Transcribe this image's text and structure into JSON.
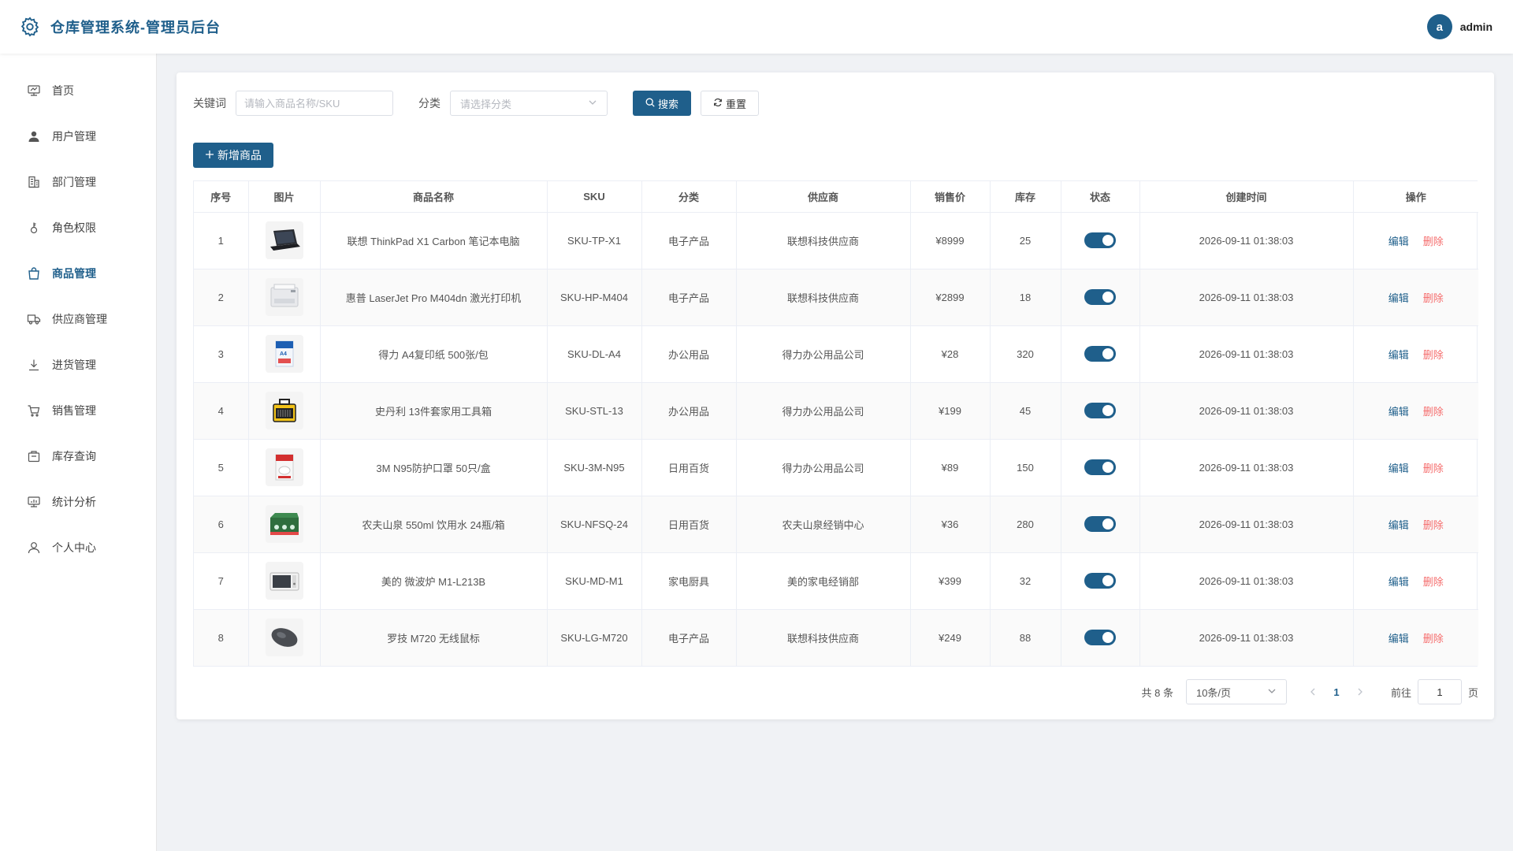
{
  "header": {
    "title": "仓库管理系统-管理员后台",
    "avatar_letter": "a",
    "username": "admin",
    "brand_color": "#1f5f8b"
  },
  "sidebar": {
    "items": [
      {
        "label": "首页",
        "icon": "dashboard-icon"
      },
      {
        "label": "用户管理",
        "icon": "user-icon"
      },
      {
        "label": "部门管理",
        "icon": "building-icon"
      },
      {
        "label": "角色权限",
        "icon": "key-icon"
      },
      {
        "label": "商品管理",
        "icon": "shopping-bag-icon",
        "active": true
      },
      {
        "label": "供应商管理",
        "icon": "truck-icon"
      },
      {
        "label": "进货管理",
        "icon": "download-icon"
      },
      {
        "label": "销售管理",
        "icon": "cart-icon"
      },
      {
        "label": "库存查询",
        "icon": "box-icon"
      },
      {
        "label": "统计分析",
        "icon": "chart-icon"
      },
      {
        "label": "个人中心",
        "icon": "profile-icon"
      }
    ]
  },
  "filters": {
    "keyword_label": "关键词",
    "keyword_placeholder": "请输入商品名称/SKU",
    "category_label": "分类",
    "category_placeholder": "请选择分类",
    "search_label": "搜索",
    "reset_label": "重置"
  },
  "add_button_label": "新增商品",
  "table": {
    "columns": [
      "序号",
      "图片",
      "商品名称",
      "SKU",
      "分类",
      "供应商",
      "销售价",
      "库存",
      "状态",
      "创建时间",
      "操作"
    ],
    "edit_label": "编辑",
    "delete_label": "删除",
    "rows": [
      {
        "index": "1",
        "image": "laptop",
        "name": "联想 ThinkPad X1 Carbon 笔记本电脑",
        "sku": "SKU-TP-X1",
        "category": "电子产品",
        "supplier": "联想科技供应商",
        "price": "¥8999",
        "stock": "25",
        "enabled": true,
        "created": "2026-09-11 01:38:03"
      },
      {
        "index": "2",
        "image": "printer",
        "name": "惠普 LaserJet Pro M404dn 激光打印机",
        "sku": "SKU-HP-M404",
        "category": "电子产品",
        "supplier": "联想科技供应商",
        "price": "¥2899",
        "stock": "18",
        "enabled": true,
        "created": "2026-09-11 01:38:03"
      },
      {
        "index": "3",
        "image": "paper",
        "name": "得力 A4复印纸 500张/包",
        "sku": "SKU-DL-A4",
        "category": "办公用品",
        "supplier": "得力办公用品公司",
        "price": "¥28",
        "stock": "320",
        "enabled": true,
        "created": "2026-09-11 01:38:03"
      },
      {
        "index": "4",
        "image": "toolbox",
        "name": "史丹利 13件套家用工具箱",
        "sku": "SKU-STL-13",
        "category": "办公用品",
        "supplier": "得力办公用品公司",
        "price": "¥199",
        "stock": "45",
        "enabled": true,
        "created": "2026-09-11 01:38:03"
      },
      {
        "index": "5",
        "image": "mask",
        "name": "3M N95防护口罩 50只/盒",
        "sku": "SKU-3M-N95",
        "category": "日用百货",
        "supplier": "得力办公用品公司",
        "price": "¥89",
        "stock": "150",
        "enabled": true,
        "created": "2026-09-11 01:38:03"
      },
      {
        "index": "6",
        "image": "water",
        "name": "农夫山泉 550ml 饮用水 24瓶/箱",
        "sku": "SKU-NFSQ-24",
        "category": "日用百货",
        "supplier": "农夫山泉经销中心",
        "price": "¥36",
        "stock": "280",
        "enabled": true,
        "created": "2026-09-11 01:38:03"
      },
      {
        "index": "7",
        "image": "microwave",
        "name": "美的 微波炉 M1-L213B",
        "sku": "SKU-MD-M1",
        "category": "家电厨具",
        "supplier": "美的家电经销部",
        "price": "¥399",
        "stock": "32",
        "enabled": true,
        "created": "2026-09-11 01:38:03"
      },
      {
        "index": "8",
        "image": "mouse",
        "name": "罗技 M720 无线鼠标",
        "sku": "SKU-LG-M720",
        "category": "电子产品",
        "supplier": "联想科技供应商",
        "price": "¥249",
        "stock": "88",
        "enabled": true,
        "created": "2026-09-11 01:38:03"
      }
    ]
  },
  "pagination": {
    "total_text": "共 8 条",
    "page_size": "10条/页",
    "current_page": "1",
    "goto_label": "前往",
    "goto_value": "1",
    "page_suffix": "页"
  }
}
